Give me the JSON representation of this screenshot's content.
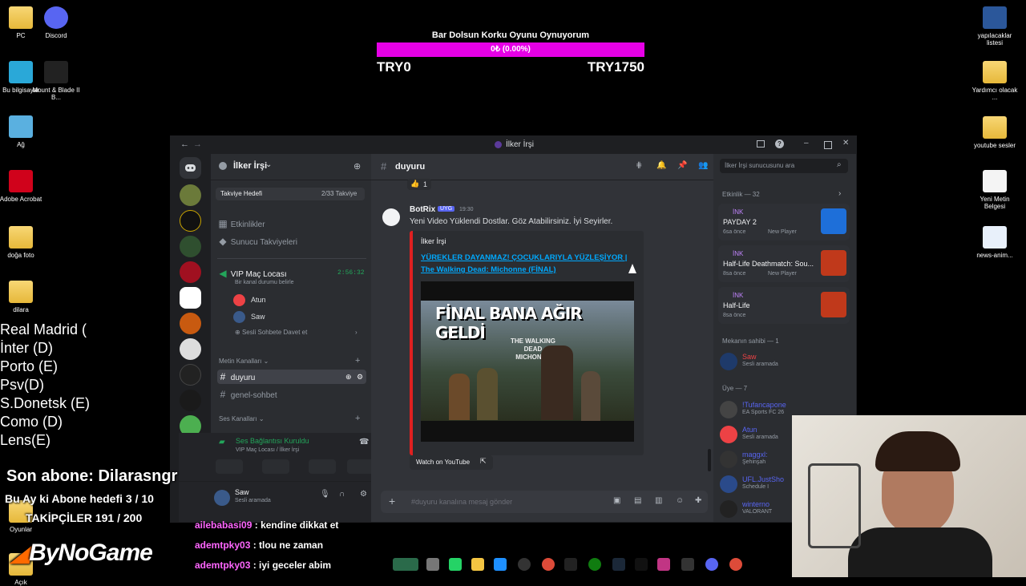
{
  "desktop_left": [
    {
      "label": "PC",
      "icon": "pc-folder-icon"
    },
    {
      "label": "Discord",
      "icon": "discord-icon"
    },
    {
      "label": "Bu bilgisayar",
      "icon": "computer-icon"
    },
    {
      "label": "Mount & Blade II B...",
      "icon": "game-icon"
    },
    {
      "label": "Ağ",
      "icon": "network-icon"
    },
    {
      "label": "Adobe Acrobat",
      "icon": "acrobat-icon"
    },
    {
      "label": "doğa foto",
      "icon": "folder-icon"
    },
    {
      "label": "dilara",
      "icon": "folder-icon"
    },
    {
      "label": "Oyunlar",
      "icon": "folder-icon"
    },
    {
      "label": "Açık",
      "icon": "folder-icon"
    }
  ],
  "desktop_right": [
    {
      "label": "yapılacaklar listesi",
      "icon": "word-icon"
    },
    {
      "label": "Yardımcı olacak ...",
      "icon": "folder-icon"
    },
    {
      "label": "youtube sesler",
      "icon": "folder-icon"
    },
    {
      "label": "Yeni Metin Belgesi",
      "icon": "text-file-icon"
    },
    {
      "label": "news-anim...",
      "icon": "image-file-icon"
    }
  ],
  "donation": {
    "title": "Bar Dolsun Korku Oyunu Oynuyorum",
    "progress_text": "0₺ (0.00%)",
    "progress": 0,
    "start": "TRY0",
    "goal": "TRY1750",
    "color": "#e600e6"
  },
  "window": {
    "title": "İlker İrşi"
  },
  "server": {
    "name": "İlker İrşi",
    "boost_label": "Takviye Hedefi",
    "boost_count": "2/33 Takviye",
    "events": "Etkinlikler",
    "boosts": "Sunucu Takviyeleri",
    "voice_channel": "VIP Maç Locası",
    "voice_timer": "2:56:32",
    "voice_status": "Bir kanal durumu belirle",
    "voice_users": [
      "Atun",
      "Saw"
    ],
    "invite": "Sesli Sohbete Davet et",
    "text_category": "Metin Kanalları",
    "channels": [
      "duyuru",
      "genel-sohbet"
    ],
    "voice_category": "Ses Kanalları"
  },
  "voice_panel": {
    "status": "Ses Bağlantısı Kuruldu",
    "location": "VIP Maç Locası / İlker İrşi",
    "user": "Saw",
    "user_status": "Sesli aramada"
  },
  "chat": {
    "channel": "duyuru",
    "reaction_count": "1",
    "author": "BotRix",
    "badge": "UYG",
    "time": "19:30",
    "message": "Yeni Video Yüklendi Dostlar. Göz Atabilirsiniz. İyi Seyirler.",
    "embed_author": "İlker İrşi",
    "embed_title": "YÜREKLER DAYANMAZ! ÇOCUKLARIYLA YÜZLEŞİYOR | The Walking Dead: Michonne (FİNAL)",
    "thumb_text": "FİNAL BANA AĞIR GELDİ",
    "thumb_sub": "THE WALKING DEAD MICHONNE",
    "watch_label": "Watch on YouTube",
    "input_placeholder": "#duyuru kanalına mesaj gönder"
  },
  "members": {
    "search_placeholder": "İlker İrşi sunucusunu ara",
    "activity_header": "Etkinlik — 32",
    "activities": [
      {
        "user": "İNK",
        "game": "PAYDAY 2",
        "time": "6sa önce",
        "tag": "New Player"
      },
      {
        "user": "İNK",
        "game": "Half-Life Deathmatch: Sou...",
        "time": "8sa önce",
        "tag": "New Player"
      },
      {
        "user": "İNK",
        "game": "Half-Life",
        "time": "8sa önce",
        "tag": ""
      }
    ],
    "owner_header": "Mekanın sahibi — 1",
    "owner": {
      "name": "Saw",
      "status": "Sesli aramada"
    },
    "members_header": "Üye — 7",
    "list": [
      {
        "name": "!Tufancapone",
        "status": "EA Sports FC 26"
      },
      {
        "name": "Atun",
        "status": "Sesli aramada"
      },
      {
        "name": "maggxl:",
        "status": "Şehinşah"
      },
      {
        "name": "UFL.JustSho",
        "status": "Schedule I"
      },
      {
        "name": "winterno",
        "status": "VALORANT"
      }
    ]
  },
  "overlay": {
    "scores": [
      "Real Madrid (",
      "İnter (D)",
      "Porto (E)",
      "Psv(D)",
      "S.Donetsk (E)",
      "Como (D)",
      "Lens(E)"
    ],
    "last_sub": "Son abone: Dilarasngr",
    "month_sub": "Bu Ay ki Abone hedefi 3 / 10",
    "followers": "TAKİPÇİLER 191 / 200",
    "brand": "ByNoGame"
  },
  "stream_chat": [
    {
      "user": "ailebabasi09",
      "text": ": kendine dikkat et"
    },
    {
      "user": "ademtpky03",
      "text": ": tlou ne zaman"
    },
    {
      "user": "ademtpky03",
      "text": ": iyi geceler abim"
    }
  ]
}
